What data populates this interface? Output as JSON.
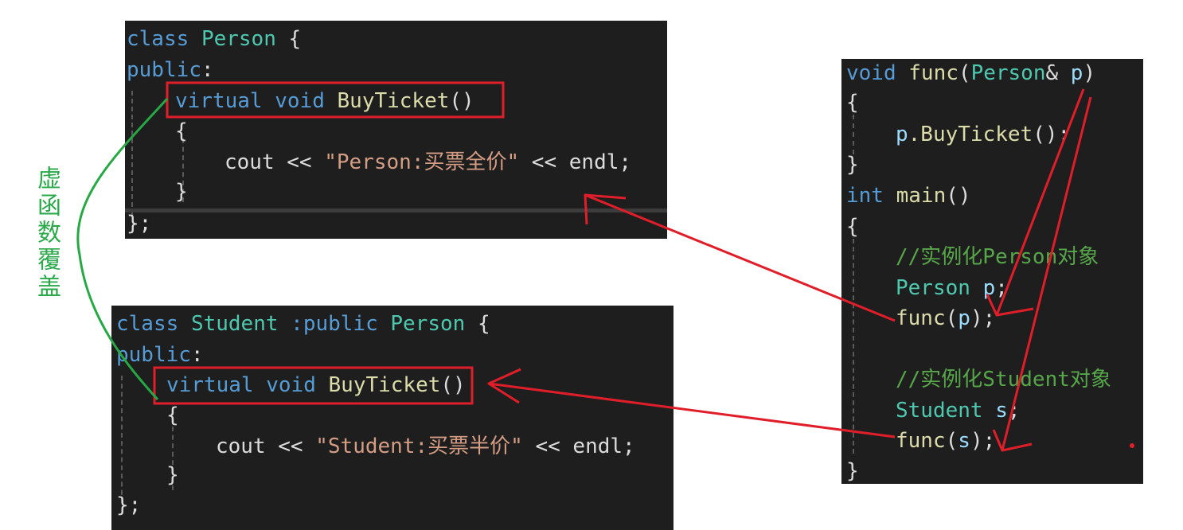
{
  "annotation": {
    "side_label": "虚函数覆盖",
    "box_color": "#e01e2a",
    "arrow_color": "#e01e2a",
    "curve_color": "#27a844"
  },
  "person_class": {
    "kw_class": "class",
    "name": "Person",
    "brace_open": " {",
    "kw_public": "public",
    "colon": ":",
    "kw_virtual": "virtual",
    "kw_void": "void",
    "method": "BuyTicket",
    "parens": "()",
    "body_open": "{",
    "cout": "cout",
    "op1": " << ",
    "string": "\"Person:买票全价\"",
    "op2": " << ",
    "endl": "endl",
    "semicolon": ";",
    "body_close": "}",
    "class_close": "};"
  },
  "student_class": {
    "kw_class": "class",
    "name": "Student",
    "inherit_kw": " :public",
    "base": "Person",
    "brace_open": " {",
    "kw_public": "public",
    "colon": ":",
    "kw_virtual": "virtual",
    "kw_void": "void",
    "method": "BuyTicket",
    "parens": "()",
    "body_open": "{",
    "cout": "cout",
    "op1": " << ",
    "string": "\"Student:买票半价\"",
    "op2": " << ",
    "endl": "endl",
    "semicolon": ";",
    "body_close": "}",
    "class_close": "};"
  },
  "main_code": {
    "kw_void": "void",
    "func_name": "func",
    "param_open": "(",
    "param_type": "Person",
    "param_ref": "&",
    "param_name": "p",
    "param_close": ")",
    "brace1_open": "{",
    "call_obj": "p",
    "call_method": ".BuyTicket",
    "call_tail": "();",
    "brace1_close": "}",
    "kw_int": "int",
    "main_name": "main",
    "main_parens": "()",
    "brace2_open": "{",
    "comment1": "//实例化Person对象",
    "decl1_type": "Person",
    "decl1_var": "p",
    "decl1_semi": ";",
    "call1_fn": "func",
    "call1_open": "(",
    "call1_arg": "p",
    "call1_close": ");",
    "comment2": "//实例化Student对象",
    "decl2_type": "Student",
    "decl2_var": "s",
    "decl2_semi": ";",
    "call2_fn": "func",
    "call2_open": "(",
    "call2_arg": "s",
    "call2_close": ");",
    "brace2_close": "}"
  }
}
